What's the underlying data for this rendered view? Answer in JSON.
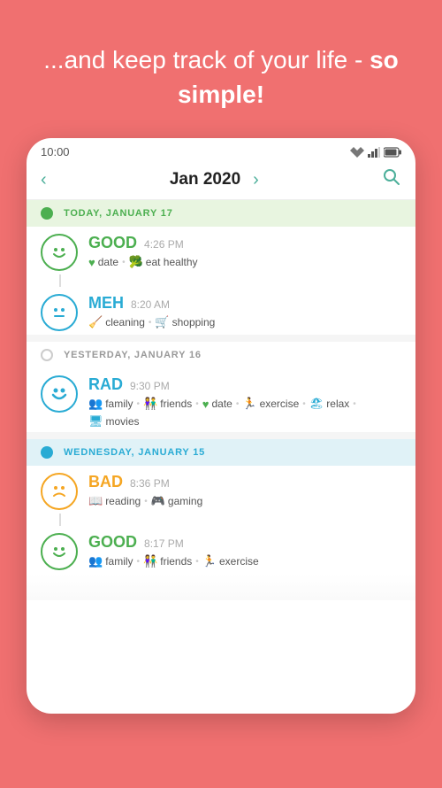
{
  "hero": {
    "text_normal": "...and keep track of your life - ",
    "text_bold": "so simple!"
  },
  "status_bar": {
    "time": "10:00"
  },
  "nav": {
    "month": "Jan 2020",
    "left_arrow": "‹",
    "right_arrow": "›"
  },
  "sections": [
    {
      "id": "today",
      "header_type": "today",
      "label": "TODAY, JANUARY 17",
      "entries": [
        {
          "mood": "GOOD",
          "mood_class": "good",
          "time": "4:26 PM",
          "tags": [
            {
              "icon": "♥",
              "icon_class": "green",
              "label": "date"
            },
            {
              "icon": "🥦",
              "icon_class": "green",
              "label": "eat healthy"
            }
          ]
        },
        {
          "mood": "MEH",
          "mood_class": "meh",
          "time": "8:20 AM",
          "tags": [
            {
              "icon": "🧹",
              "icon_class": "teal",
              "label": "cleaning"
            },
            {
              "icon": "🛒",
              "icon_class": "teal",
              "label": "shopping"
            }
          ]
        }
      ]
    },
    {
      "id": "yesterday",
      "header_type": "yesterday",
      "label": "YESTERDAY, JANUARY 16",
      "entries": [
        {
          "mood": "RAD",
          "mood_class": "rad",
          "time": "9:30 PM",
          "tags": [
            {
              "icon": "👥",
              "icon_class": "teal",
              "label": "family"
            },
            {
              "icon": "👫",
              "icon_class": "teal",
              "label": "friends"
            },
            {
              "icon": "♥",
              "icon_class": "green",
              "label": "date"
            },
            {
              "icon": "🏃",
              "icon_class": "teal",
              "label": "exercise"
            },
            {
              "icon": "🏖",
              "icon_class": "teal",
              "label": "relax"
            },
            {
              "icon": "🖥",
              "icon_class": "teal",
              "label": "movies"
            }
          ]
        }
      ]
    },
    {
      "id": "wednesday",
      "header_type": "wednesday",
      "label": "WEDNESDAY, JANUARY 15",
      "entries": [
        {
          "mood": "BAD",
          "mood_class": "bad",
          "time": "8:36 PM",
          "tags": [
            {
              "icon": "📖",
              "icon_class": "orange",
              "label": "reading"
            },
            {
              "icon": "🎮",
              "icon_class": "orange",
              "label": "gaming"
            }
          ]
        },
        {
          "mood": "GOOD",
          "mood_class": "good",
          "time": "8:17 PM",
          "tags": [
            {
              "icon": "👥",
              "icon_class": "green",
              "label": "family"
            },
            {
              "icon": "👫",
              "icon_class": "green",
              "label": "friends"
            },
            {
              "icon": "🏃",
              "icon_class": "green",
              "label": "exercise"
            }
          ]
        }
      ]
    }
  ]
}
